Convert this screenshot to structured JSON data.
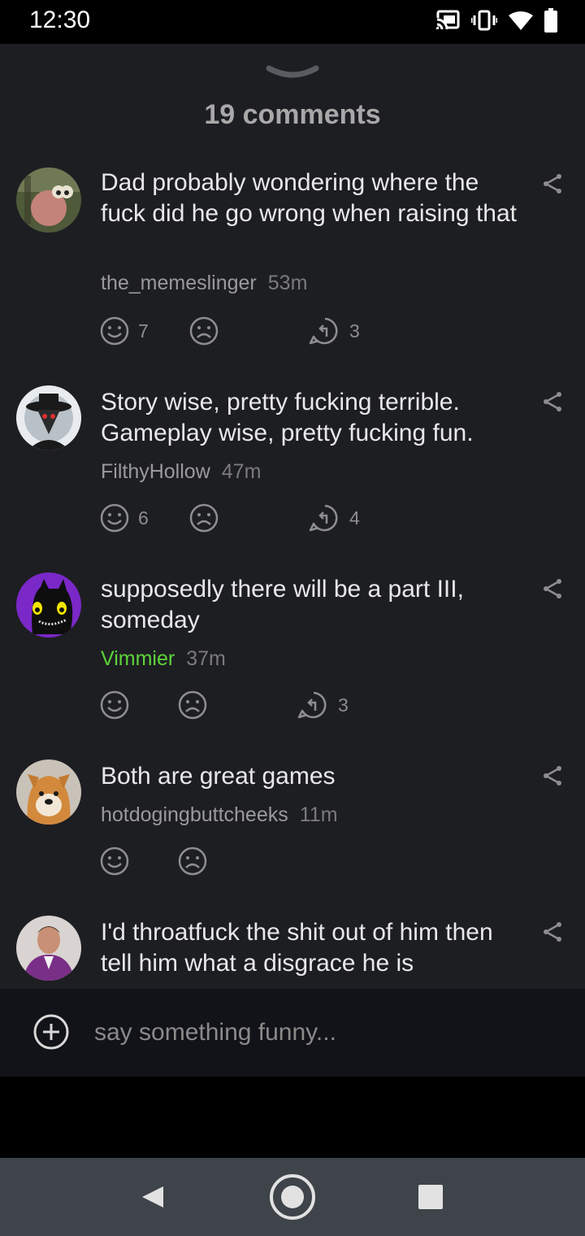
{
  "status_bar": {
    "time": "12:30"
  },
  "sheet": {
    "title": "19 comments"
  },
  "comments": [
    {
      "text": "Dad probably wondering where the fuck did he go wrong when raising that",
      "user": "the_memeslinger",
      "time": "53m",
      "likes": "7",
      "replies": "3"
    },
    {
      "text": "Story wise, pretty fucking terrible. Gameplay wise, pretty fucking fun.",
      "user": "FilthyHollow",
      "time": "47m",
      "likes": "6",
      "replies": "4"
    },
    {
      "text": "supposedly there will be a part III, someday",
      "user": "Vimmier",
      "time": "37m",
      "likes": "",
      "replies": "3",
      "user_color": "#5dd43a"
    },
    {
      "text": "Both are great games",
      "user": "hotdogingbuttcheeks",
      "time": "11m",
      "likes": "",
      "replies": ""
    },
    {
      "text": "I'd throatfuck the shit out of him then tell him what a disgrace he is",
      "user": "",
      "time": "",
      "likes": "",
      "replies": ""
    }
  ],
  "input": {
    "placeholder": "say something funny..."
  },
  "colors": {
    "sheet_bg": "#1d1e22",
    "accent_green": "#5dd43a",
    "nav_bg": "#3e4449"
  },
  "icons": {
    "status": [
      "cast-icon",
      "vibrate-icon",
      "wifi-icon",
      "battery-icon"
    ],
    "comment_actions": [
      "smile-icon",
      "frown-icon",
      "reply-icon",
      "share-icon"
    ],
    "nav": [
      "back-icon",
      "home-icon",
      "recents-icon"
    ]
  }
}
